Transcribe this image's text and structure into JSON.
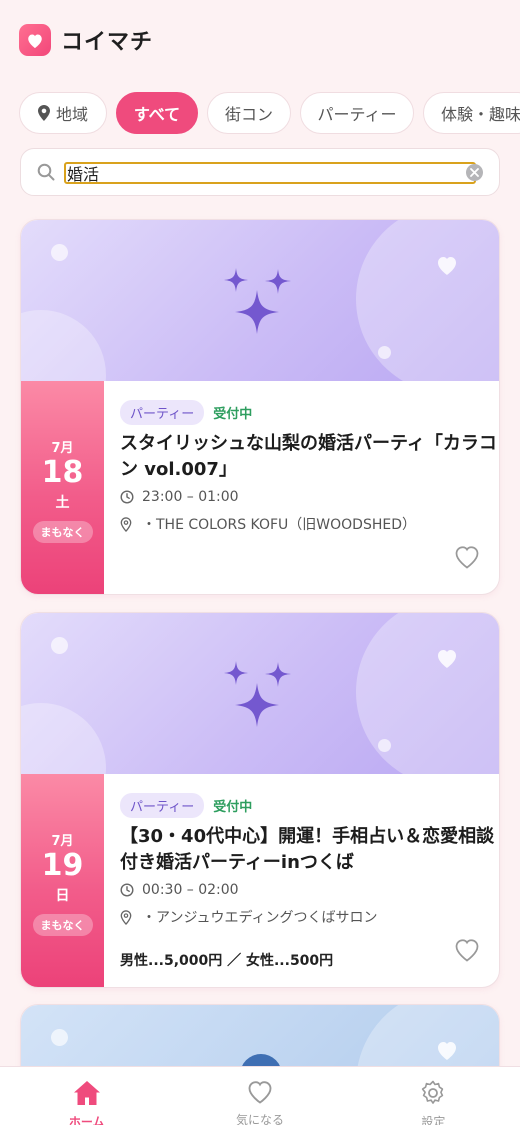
{
  "app": {
    "title": "コイマチ",
    "accent": "#ef4b7d"
  },
  "filters": [
    {
      "label": "地域",
      "icon": "location-pin-icon",
      "active": false
    },
    {
      "label": "すべて",
      "active": true
    },
    {
      "label": "街コン",
      "active": false
    },
    {
      "label": "パーティー",
      "active": false
    },
    {
      "label": "体験・趣味",
      "active": false
    }
  ],
  "search": {
    "value": "婚活",
    "icon": "search-icon",
    "clear_icon": "clear-icon"
  },
  "events": [
    {
      "month": "7月",
      "day": "18",
      "weekday": "土",
      "badge": "まもなく",
      "category": "パーティー",
      "status": "受付中",
      "title": "スタイリッシュな山梨の婚活パーティ「カラコン vol.007」",
      "time": "23:00 – 01:00",
      "venue": "・THE COLORS KOFU（旧WOODSHED）",
      "price": ""
    },
    {
      "month": "7月",
      "day": "19",
      "weekday": "日",
      "badge": "まもなく",
      "category": "パーティー",
      "status": "受付中",
      "title": "【30・40代中心】開運！手相占い＆恋愛相談付き婚活パーティーinつくば",
      "time": "00:30 – 02:00",
      "venue": "・アンジュウエディングつくばサロン",
      "price": "男性...5,000円 ／ 女性...500円"
    }
  ],
  "nav": [
    {
      "label": "ホーム",
      "icon": "home-icon",
      "active": true
    },
    {
      "label": "気になる",
      "icon": "heart-icon",
      "active": false
    },
    {
      "label": "設定",
      "icon": "gear-icon",
      "active": false
    }
  ]
}
